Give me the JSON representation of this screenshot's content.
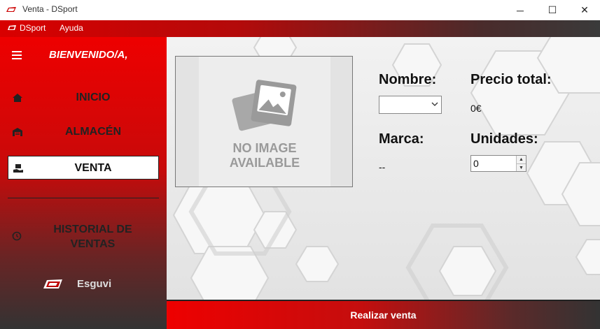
{
  "window": {
    "title": "Venta - DSport",
    "controls": {
      "minimize": "─",
      "maximize": "☐",
      "close": "✕"
    }
  },
  "menubar": {
    "items": [
      {
        "label": "DSport",
        "icon": "dsport-logo-icon"
      },
      {
        "label": "Ayuda"
      }
    ]
  },
  "sidebar": {
    "welcome": "BIENVENIDO/A,",
    "items": [
      {
        "label": "INICIO",
        "icon": "home-icon",
        "active": false
      },
      {
        "label": "ALMACÉN",
        "icon": "warehouse-icon",
        "active": false
      },
      {
        "label": "VENTA",
        "icon": "sale-icon",
        "active": true
      }
    ],
    "history_label_line1": "HISTORIAL DE",
    "history_label_line2": "VENTAS",
    "user_name": "Esguvi",
    "accent": "#e00000"
  },
  "main": {
    "no_image_line1": "NO IMAGE",
    "no_image_line2": "AVAILABLE",
    "nombre_label": "Nombre:",
    "nombre_value": "",
    "marca_label": "Marca:",
    "marca_value": "--",
    "precio_label": "Precio total:",
    "precio_value": "0€",
    "unidades_label": "Unidades:",
    "unidades_value": "0"
  },
  "action": {
    "label": "Realizar venta"
  }
}
